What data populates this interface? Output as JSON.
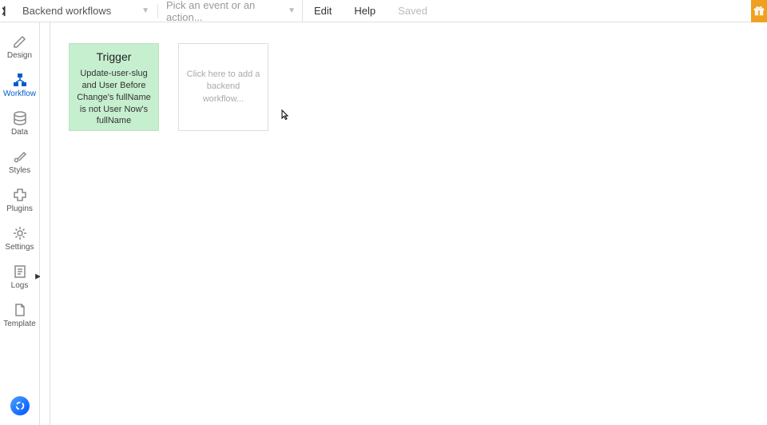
{
  "topbar": {
    "pageDropdown": "Backend workflows",
    "actionDropdown": "Pick an event or an action...",
    "edit": "Edit",
    "help": "Help",
    "saved": "Saved"
  },
  "sidebar": {
    "design": "Design",
    "workflow": "Workflow",
    "data": "Data",
    "styles": "Styles",
    "plugins": "Plugins",
    "settings": "Settings",
    "logs": "Logs",
    "template": "Template"
  },
  "canvas": {
    "trigger": {
      "title": "Trigger",
      "body": "Update-user-slug and User Before Change's fullName is not User Now's fullName"
    },
    "addCard": "Click here to add a backend workflow..."
  }
}
